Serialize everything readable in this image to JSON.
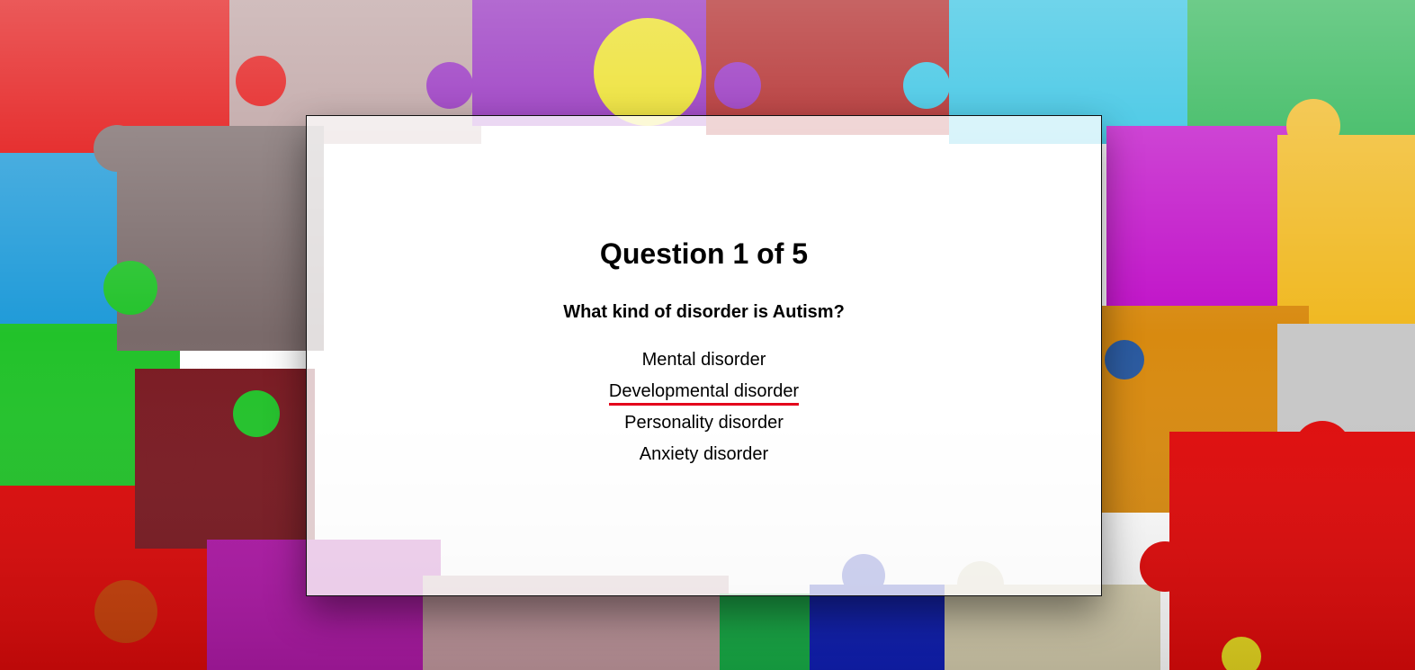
{
  "quiz": {
    "counter": "Question 1 of 5",
    "question": "What kind of disorder is Autism?",
    "answers": [
      {
        "label": "Mental disorder"
      },
      {
        "label": "Developmental disorder"
      },
      {
        "label": "Personality disorder"
      },
      {
        "label": "Anxiety disorder"
      }
    ],
    "hovered_answer_index": 1
  },
  "colors": {
    "hover_underline": "#e3001b",
    "card_border": "#111111",
    "text": "#000000"
  },
  "background": {
    "theme": "colorful-puzzle-pieces"
  }
}
